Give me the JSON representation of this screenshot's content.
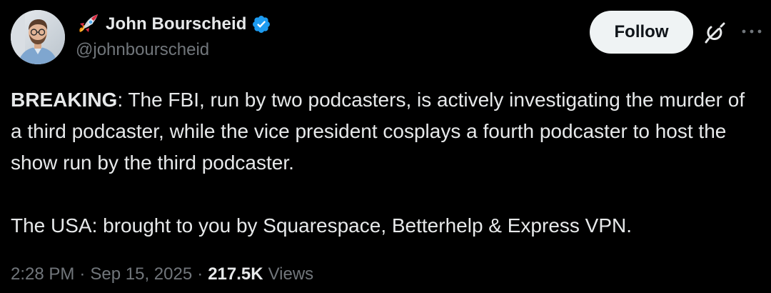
{
  "author": {
    "display_name": "John Bourscheid",
    "handle": "@johnbourscheid",
    "avatar_icon": "profile-photo",
    "name_emoji": "rocket-icon",
    "verified_icon": "verified-badge-icon",
    "verified_color": "#1d9bf0"
  },
  "actions": {
    "follow_label": "Follow",
    "grok_icon": "grok-icon",
    "more_icon": "more-dots-icon"
  },
  "tweet": {
    "breaking_label": "BREAKING",
    "paragraph1_rest": ": The FBI, run by two podcasters, is actively investigating the murder of a third podcaster, while the vice president cosplays a fourth podcaster to host the show run by the third podcaster.",
    "paragraph2": "The USA: brought to you by Squarespace, Betterhelp & Express VPN."
  },
  "meta": {
    "time": "2:28 PM",
    "separator": "·",
    "date": "Sep 15, 2025",
    "views_count": "217.5K",
    "views_label": "Views"
  },
  "colors": {
    "background": "#000000",
    "primary_text": "#e7e9ea",
    "secondary_text": "#71767b",
    "follow_bg": "#eff3f4",
    "follow_text": "#0f1419"
  }
}
